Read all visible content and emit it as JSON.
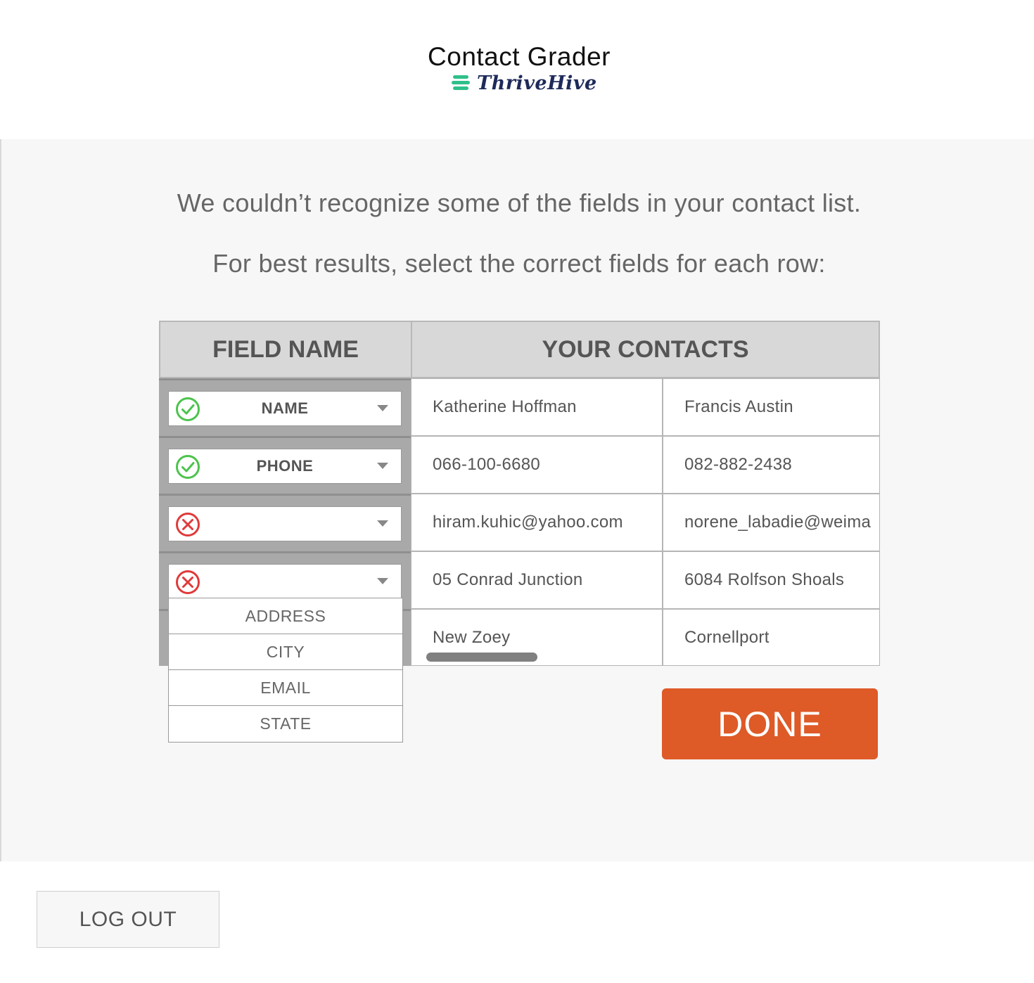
{
  "header": {
    "title": "Contact Grader",
    "brand": "ThriveHive"
  },
  "messages": {
    "line1": "We couldn’t recognize some of the fields in your contact list.",
    "line2": "For best results, select the correct fields for each row:"
  },
  "table": {
    "headers": {
      "field_name": "FIELD NAME",
      "your_contacts": "YOUR CONTACTS"
    },
    "rows": [
      {
        "field": "NAME",
        "status": "valid",
        "values": [
          "Katherine Hoffman",
          "Francis Austin"
        ]
      },
      {
        "field": "PHONE",
        "status": "valid",
        "values": [
          "066-100-6680",
          "082-882-2438"
        ]
      },
      {
        "field": "",
        "status": "invalid",
        "values": [
          "hiram.kuhic@yahoo.com",
          "norene_labadie@weima"
        ]
      },
      {
        "field": "",
        "status": "invalid",
        "values": [
          "05 Conrad Junction",
          "6084 Rolfson Shoals"
        ]
      },
      {
        "field": "",
        "status": "",
        "values": [
          "New Zoey",
          "Cornellport"
        ]
      }
    ]
  },
  "dropdown": {
    "options": [
      "ADDRESS",
      "CITY",
      "EMAIL",
      "STATE"
    ]
  },
  "buttons": {
    "done": "DONE",
    "logout": "LOG OUT"
  },
  "colors": {
    "accent": "#de5a27",
    "valid": "#4cc34c",
    "invalid": "#e03a3a",
    "brand_green": "#2fc08a",
    "brand_navy": "#1e2a5a"
  }
}
